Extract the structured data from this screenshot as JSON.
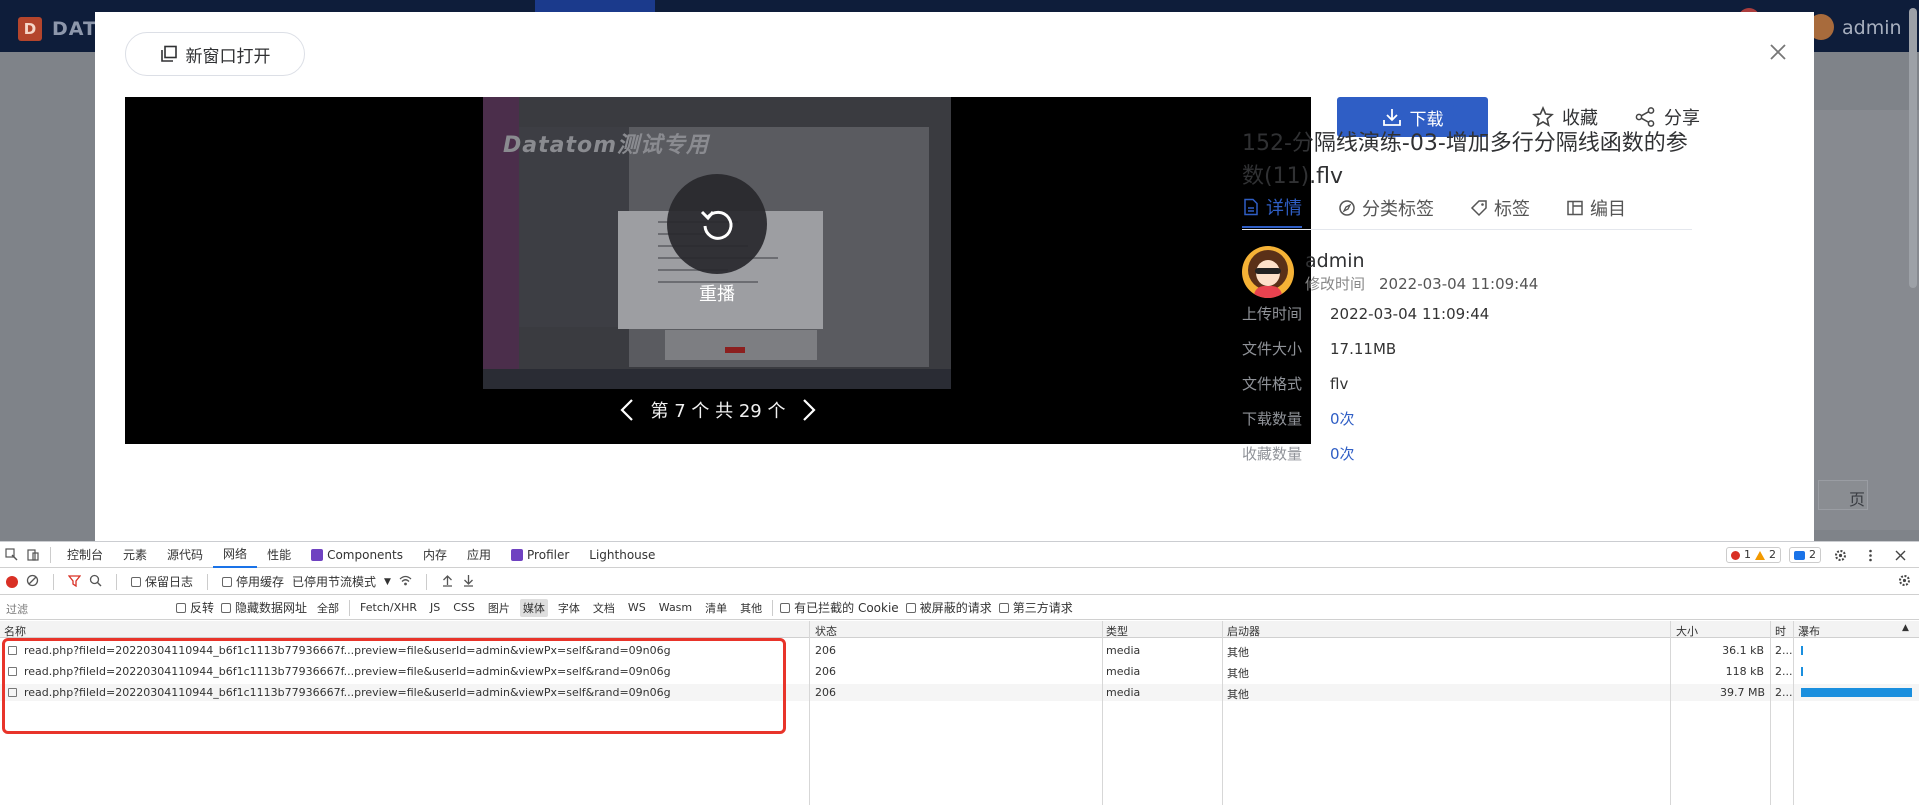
{
  "app": {
    "brand": "DAT",
    "user": "admin",
    "bg_page_label": "页"
  },
  "modal": {
    "open_new_label": "新窗口打开",
    "player": {
      "watermark": "Datatom测试专用",
      "replay_label": "重播",
      "pager_label": "第 7 个 共 29 个"
    },
    "actions": {
      "download": "下载",
      "favorite": "收藏",
      "share": "分享"
    },
    "title": "152-分隔线演练-03-增加多行分隔线函数的参数(11).flv",
    "tabs": [
      {
        "label": "详情",
        "icon": "document-icon",
        "active": true
      },
      {
        "label": "分类标签",
        "icon": "compass-icon",
        "active": false
      },
      {
        "label": "标签",
        "icon": "tag-icon",
        "active": false
      },
      {
        "label": "编目",
        "icon": "catalog-icon",
        "active": false
      }
    ],
    "owner": {
      "name": "admin",
      "modified_label": "修改时间",
      "modified_value": "2022-03-04 11:09:44"
    },
    "info": [
      {
        "key": "上传时间",
        "value": "2022-03-04 11:09:44",
        "link": false
      },
      {
        "key": "文件大小",
        "value": "17.11MB",
        "link": false
      },
      {
        "key": "文件格式",
        "value": "flv",
        "link": false
      },
      {
        "key": "下载数量",
        "value": "0次",
        "link": true
      },
      {
        "key": "收藏数量",
        "value": "0次",
        "link": true
      }
    ]
  },
  "devtools": {
    "tabs": [
      "控制台",
      "元素",
      "源代码",
      "网络",
      "性能",
      "Components",
      "内存",
      "应用",
      "Profiler",
      "Lighthouse"
    ],
    "active_tab": "网络",
    "errors": "1",
    "warnings": "2",
    "messages": "2",
    "toolbar": {
      "preserve_log": "保留日志",
      "disable_cache": "停用缓存",
      "throttle": "已停用节流模式"
    },
    "filter": {
      "placeholder": "过滤",
      "invert": "反转",
      "hide_data_urls": "隐藏数据网址",
      "types": [
        "全部",
        "Fetch/XHR",
        "JS",
        "CSS",
        "图片",
        "媒体",
        "字体",
        "文档",
        "WS",
        "Wasm",
        "清单",
        "其他"
      ],
      "active_type": "媒体",
      "blocked_cookies": "有已拦截的 Cookie",
      "blocked_requests": "被屏蔽的请求",
      "third_party": "第三方请求"
    },
    "columns": [
      "名称",
      "状态",
      "类型",
      "启动器",
      "大小",
      "时",
      "瀑布"
    ],
    "rows": [
      {
        "name": "read.php?fileId=20220304110944_b6f1c1113b77936667f...preview=file&userId=admin&viewPx=self&rand=09n06g",
        "status": "206",
        "type": "media",
        "initiator": "其他",
        "size": "36.1 kB",
        "time": "2...",
        "waterfall": 0.01
      },
      {
        "name": "read.php?fileId=20220304110944_b6f1c1113b77936667f...preview=file&userId=admin&viewPx=self&rand=09n06g",
        "status": "206",
        "type": "media",
        "initiator": "其他",
        "size": "118 kB",
        "time": "2...",
        "waterfall": 0.01
      },
      {
        "name": "read.php?fileId=20220304110944_b6f1c1113b77936667f...preview=file&userId=admin&viewPx=self&rand=09n06g",
        "status": "206",
        "type": "media",
        "initiator": "其他",
        "size": "39.7 MB",
        "time": "2...",
        "waterfall": 0.96
      }
    ]
  }
}
